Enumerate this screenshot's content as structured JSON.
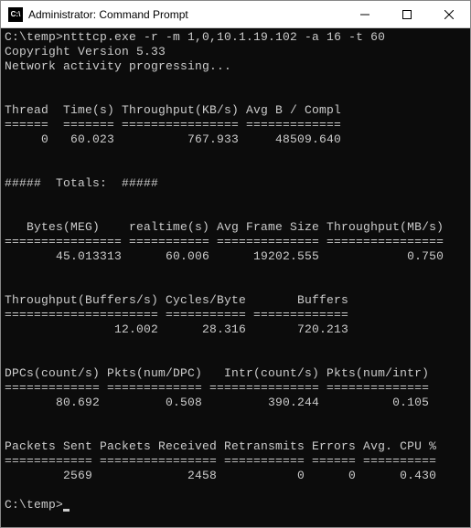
{
  "window": {
    "title": "Administrator: Command Prompt",
    "icon_text": "C:\\"
  },
  "terminal": {
    "prompt1": "C:\\temp>",
    "command": "ntttcp.exe -r -m 1,0,10.1.19.102 -a 16 -t 60",
    "copyright": "Copyright Version 5.33",
    "progressing": "Network activity progressing...",
    "table1": {
      "header": "Thread  Time(s) Throughput(KB/s) Avg B / Compl",
      "sep": "======  ======= ================ =============",
      "row": "     0   60.023          767.933     48509.640"
    },
    "totals_label": "#####  Totals:  #####",
    "table2": {
      "header": "   Bytes(MEG)    realtime(s) Avg Frame Size Throughput(MB/s)",
      "sep": "================ =========== ============== ================",
      "row": "       45.013313      60.006      19202.555            0.750"
    },
    "table3": {
      "header": "Throughput(Buffers/s) Cycles/Byte       Buffers",
      "sep": "===================== =========== =============",
      "row": "               12.002      28.316       720.213"
    },
    "table4": {
      "header": "DPCs(count/s) Pkts(num/DPC)   Intr(count/s) Pkts(num/intr)",
      "sep": "============= ============= =============== ==============",
      "row": "       80.692         0.508         390.244          0.105"
    },
    "table5": {
      "header": "Packets Sent Packets Received Retransmits Errors Avg. CPU %",
      "sep": "============ ================ =========== ====== ==========",
      "row": "        2569             2458           0      0      0.430"
    },
    "prompt2": "C:\\temp>"
  }
}
